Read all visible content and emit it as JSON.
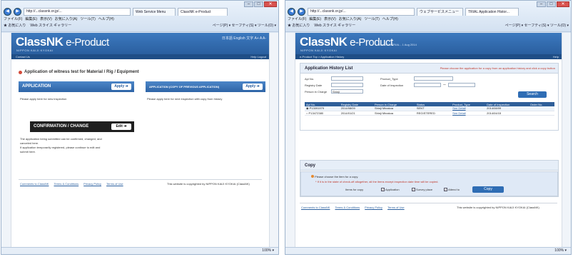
{
  "left": {
    "browser": {
      "address": "http://...classnk.or.jp/...",
      "tabs": [
        "Web Service Menu",
        "ClassNK e-Product"
      ],
      "menu": [
        "ファイル(F)",
        "編集(E)",
        "表示(V)",
        "お気に入り(A)",
        "ツール(T)",
        "ヘルプ(H)"
      ],
      "favorites": [
        "お気に入り",
        "Web スライス ギャラリー"
      ],
      "tools": "ページ(P) ▾  セーフティ(S) ▾  ツール(O) ▾",
      "zoom": "100%"
    },
    "page": {
      "logo": "ClassNK",
      "logo_product": " e-Product",
      "logo_sub": "NIPPON KAIJI KYOKAI",
      "version": "Ver.0.0.6",
      "header_links": "日本語  English  文字  A+  A  A-",
      "userbar_left": "Contact Us",
      "userbar_right": "Help  Logout",
      "section_title": "Application of witness test for Material / Rig / Equipment",
      "application_label": "APPLICATION",
      "apply_label": "Apply",
      "application_desc": "Please apply here for new inspection",
      "copy_app_label": "APPLICATION (COPY OF PREVIOUS APPLICATION)",
      "copy_apply_label": "Apply",
      "copy_desc": "Please apply here for next inspection with copy from history",
      "confirm_label": "CONFIRMATION / CHANGE",
      "edit_label": "Edit",
      "confirm_desc": [
        "The application being submitted can be confirmed, changed, and",
        "canceled here.",
        "If application temporarily registered, please continue to edit and",
        "submit here."
      ],
      "footer_links": [
        "Comments to ClassNK",
        "Terms & Conditions",
        "Privacy Policy",
        "Terms of Use"
      ],
      "copyright": "This website is copyrighted by NIPPON KAIJI KYOKAI (ClassNK)"
    }
  },
  "right": {
    "browser": {
      "address": "http://...classnk.or.jp/...",
      "tabs": [
        "ウェブサービスメニュー",
        "TRIAL Application Histor..."
      ],
      "menu": [
        "ファイル(F)",
        "編集(E)",
        "表示(V)",
        "お気に入り(A)",
        "ツール(T)",
        "ヘルプ(H)"
      ],
      "favorites": [
        "お気に入り",
        "Web スライス ギャラリー"
      ],
      "tools": "ページ(P) ▾  セーフティ(S) ▾  ツール(O) ▾",
      "zoom": "100%"
    },
    "page": {
      "logo": "ClassNK",
      "logo_product": " e-Product",
      "logo_sub": "NIPPON KAIJI KYOKAI",
      "version": "Ver.0.0.6  TRIAL - 1 Aug 2014",
      "userbar_left": "e-Product Top  >  Application History",
      "userbar_right": "Help",
      "history_title": "Application History List",
      "history_note": "Please choose the application for a copy from an application history and click a copy button",
      "fields": {
        "apl_no": "Apl No.",
        "product_type": "Product_Type",
        "registry_date": "Registry Date",
        "date_of_inspection": "Date of Inspection",
        "person_in_charge": "Person in Charge",
        "person_value": "Shinji"
      },
      "search_label": "Search",
      "columns": [
        "Apl No.",
        "Registry Date",
        "Person in Charge",
        "Status",
        "Product_Type",
        "Date of Inspection",
        "Order No."
      ],
      "rows": [
        {
          "apl": "P13091979",
          "reg": "2014/08/09",
          "person": "Shinji Minakoa",
          "status": "SENT",
          "type": "See Detail",
          "insp": "2014/08/09",
          "order": ""
        },
        {
          "apl": "P13472380",
          "reg": "2014/01/21",
          "person": "Shinji Minakoa",
          "status": "REGISTERED",
          "type": "See Detail",
          "insp": "2014/04/15",
          "order": ""
        }
      ],
      "copy_title": "Copy",
      "copy_instruction": "Please choose the item for a copy.",
      "copy_warning": "* If it is in the state of check-off altogether, all the items except inspection date time will be copied.",
      "items_for_copy": "Items for copy",
      "opt_application": "Application",
      "opt_survey": "Survey place",
      "opt_attend": "Attend to",
      "copy_button": "Copy",
      "footer_links": [
        "Comments to ClassNK",
        "Terms & Conditions",
        "Privacy Policy",
        "Terms of Use"
      ],
      "copyright": "This website is copyrighted by NIPPON KAIJI KYOKAI (ClassNK)"
    }
  }
}
